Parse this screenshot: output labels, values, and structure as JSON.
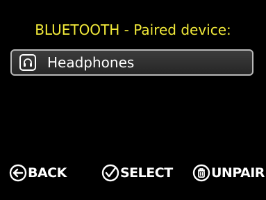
{
  "header": {
    "title": "BLUETOOTH - Paired device:"
  },
  "devices": [
    {
      "label": "Headphones",
      "icon": "headphones-icon",
      "selected": true
    }
  ],
  "softkeys": {
    "back": {
      "label": "BACK",
      "icon": "back-arrow-icon"
    },
    "select": {
      "label": "SELECT",
      "icon": "checkmark-icon"
    },
    "unpair": {
      "label": "UNPAIR",
      "icon": "trash-icon"
    }
  },
  "colors": {
    "title": "#f2ea3a",
    "text": "#ffffff",
    "background": "#000000",
    "row_border": "#b9b9b9"
  }
}
